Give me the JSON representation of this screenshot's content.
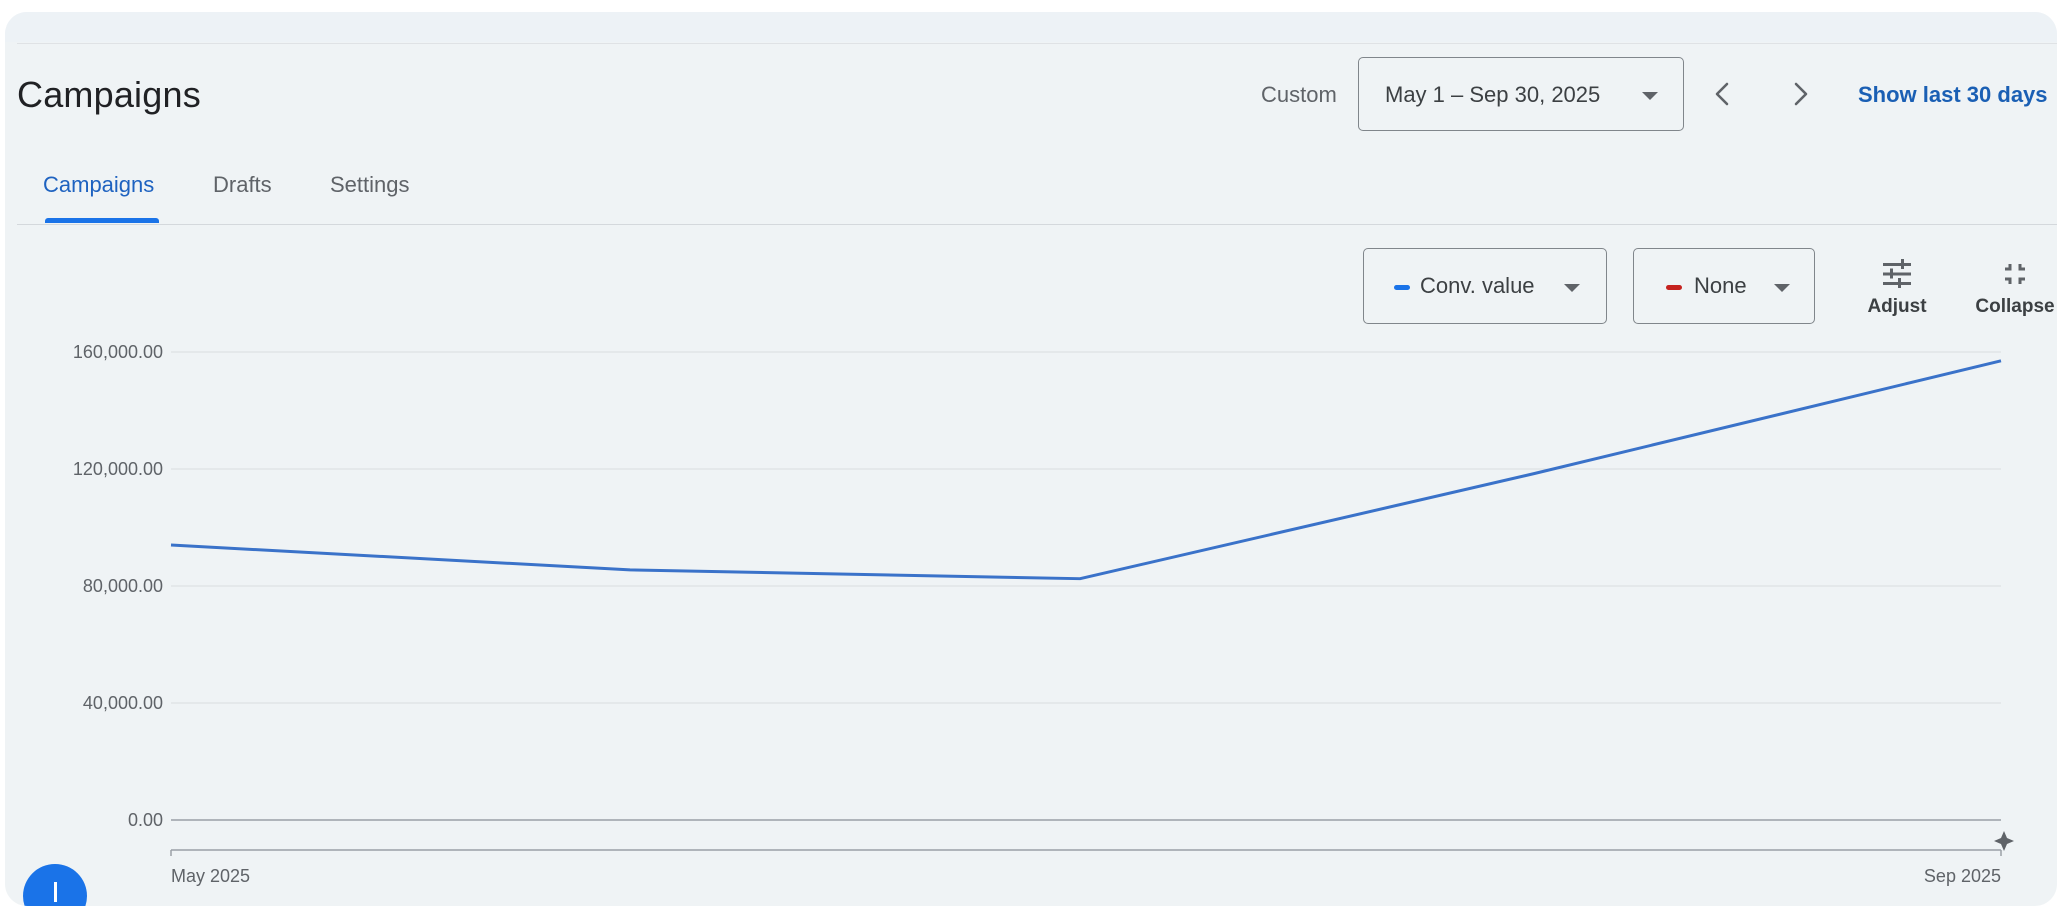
{
  "header": {
    "title": "Campaigns",
    "date_range_type": "Custom",
    "date_range": "May 1 – Sep 30, 2025",
    "show_last_label": "Show last 30 days"
  },
  "tabs": [
    {
      "label": "Campaigns",
      "active": true
    },
    {
      "label": "Drafts",
      "active": false
    },
    {
      "label": "Settings",
      "active": false
    }
  ],
  "toolbar": {
    "metric1_label": "Conv. value",
    "metric1_color": "#1a73e8",
    "metric2_label": "None",
    "metric2_color": "#c5221f",
    "adjust_label": "Adjust",
    "collapse_label": "Collapse"
  },
  "chart_data": {
    "type": "line",
    "x_labels": [
      "May 2025",
      "Sep 2025"
    ],
    "yticks": [
      "160,000.00",
      "120,000.00",
      "80,000.00",
      "40,000.00",
      "0.00"
    ],
    "ylim": [
      0,
      160000
    ],
    "grid": true,
    "series": [
      {
        "name": "Conv. value",
        "color": "#3a72c9",
        "points": [
          {
            "x": "2025-05",
            "y": 94000
          },
          {
            "x": "2025-06",
            "y": 85500
          },
          {
            "x": "2025-07",
            "y": 82500
          },
          {
            "x": "2025-08",
            "y": 118500
          },
          {
            "x": "2025-09",
            "y": 157000
          }
        ]
      }
    ]
  }
}
